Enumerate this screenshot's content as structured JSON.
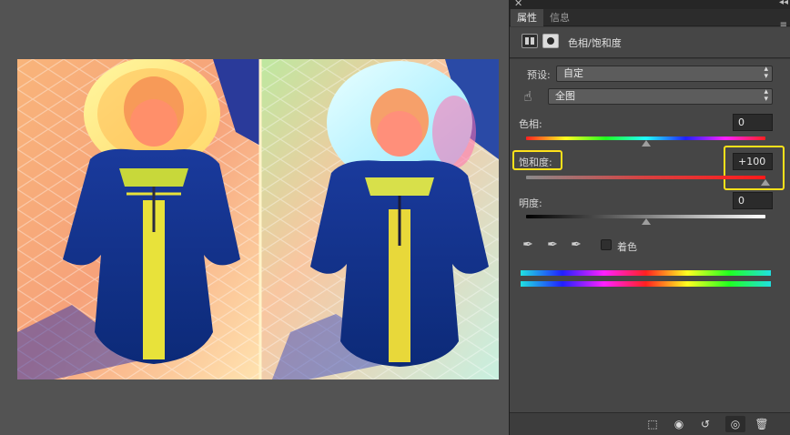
{
  "panel": {
    "tabs": [
      {
        "label": "属性"
      },
      {
        "label": "信息"
      }
    ],
    "adjustment_title": "色相/饱和度",
    "preset": {
      "label": "预设:",
      "value": "自定"
    },
    "channel": {
      "value": "全图"
    },
    "hue": {
      "label": "色相:",
      "value": "0"
    },
    "saturation": {
      "label": "饱和度:",
      "value": "+100"
    },
    "lightness": {
      "label": "明度:",
      "value": "0"
    },
    "colorize": {
      "label": "着色",
      "checked": false
    }
  },
  "icons": {
    "close": "✕",
    "collapse": "◂◂",
    "panel_menu": "≡",
    "hand": "☝",
    "eyedropper": "✒"
  },
  "colors": {
    "highlight": "#ffe11a",
    "panel_bg": "#464646",
    "canvas_bg": "#535353"
  }
}
